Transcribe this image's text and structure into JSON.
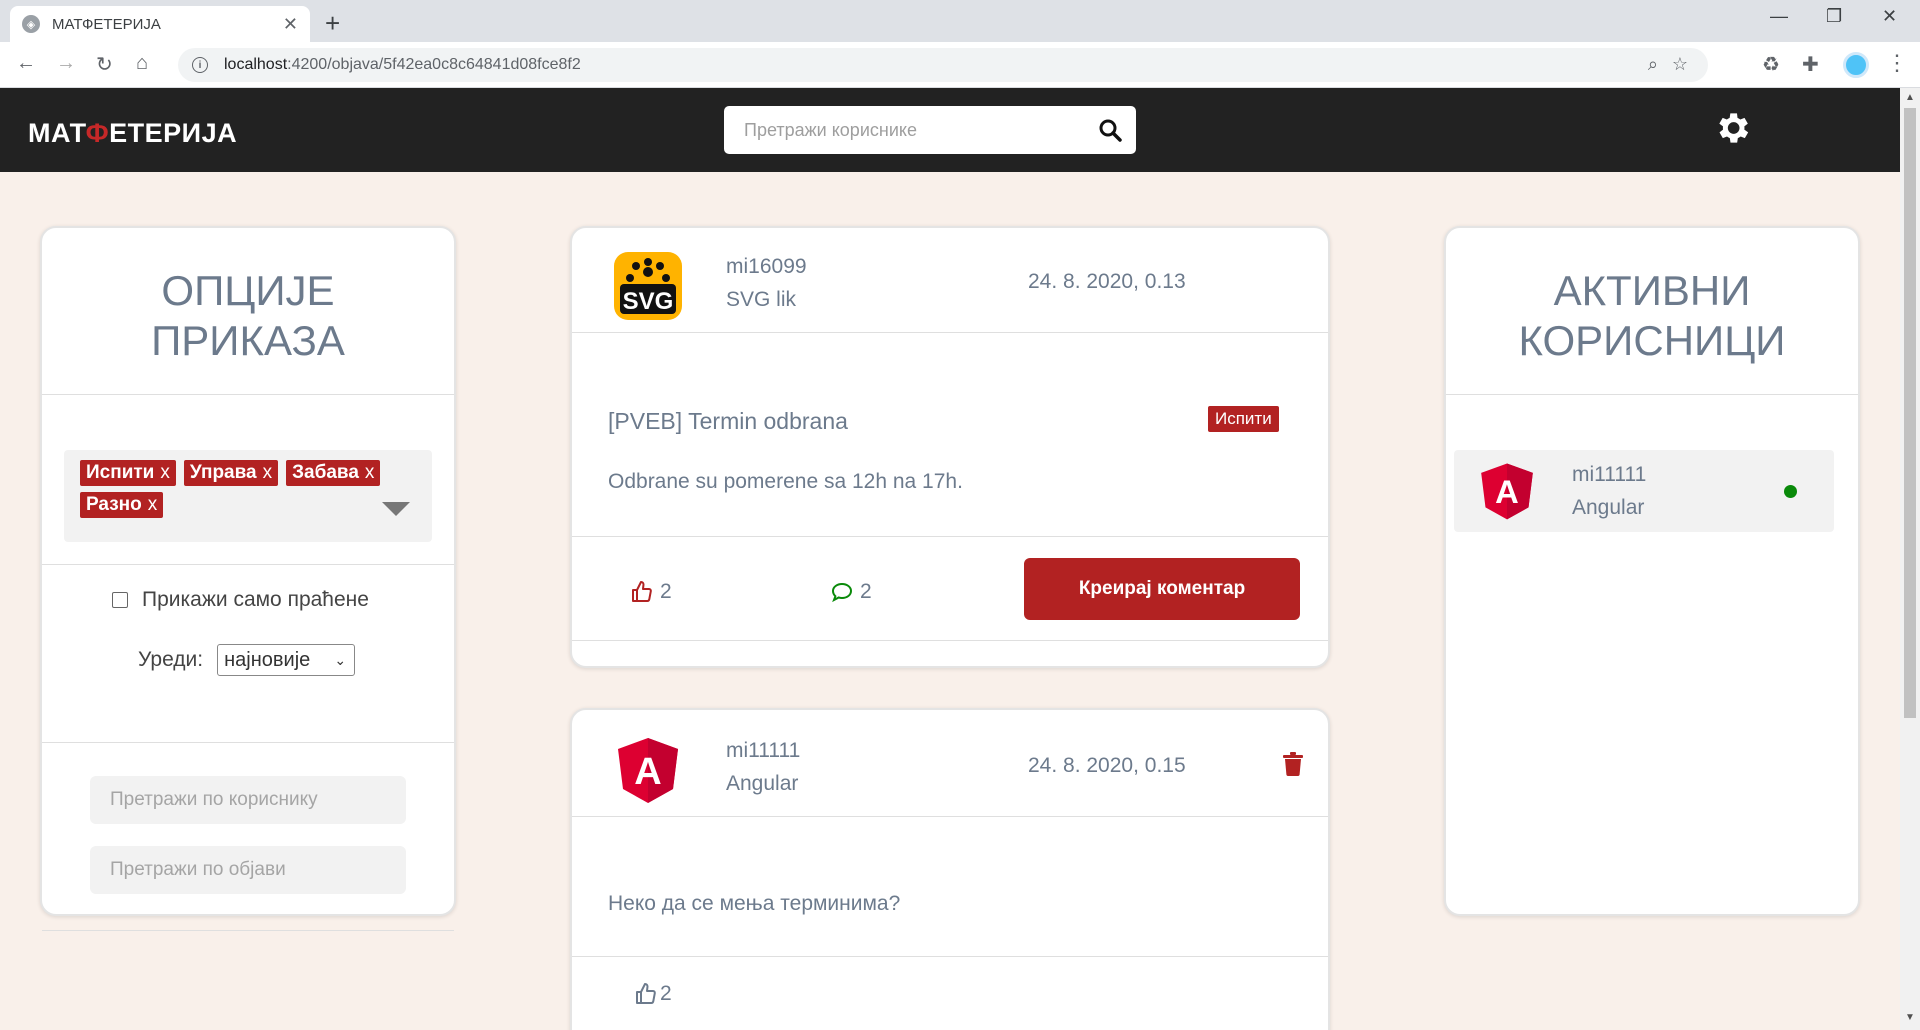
{
  "browser": {
    "tab_title": "МАТФЕТЕРИЈА",
    "new_tab": "+",
    "url_host": "localhost",
    "url_path": ":4200/objava/5f42ea0c8c64841d08fce8f2",
    "minimize": "—",
    "restore": "❐",
    "close": "✕"
  },
  "header": {
    "logo_pre": "МАТ",
    "logo_phi": "Ф",
    "logo_post": "ЕТЕРИЈА",
    "search_placeholder": "Претражи кориснике"
  },
  "left_panel": {
    "title_line1": "ОПЦИЈЕ",
    "title_line2": "ПРИКАЗА",
    "chips": [
      {
        "label": "Испити",
        "remove": "x"
      },
      {
        "label": "Управа",
        "remove": "x"
      },
      {
        "label": "Забава",
        "remove": "x"
      },
      {
        "label": "Разно",
        "remove": "x"
      }
    ],
    "follow_label": "Прикажи само праћене",
    "sort_label": "Уреди:",
    "sort_value": "најновије",
    "user_search_placeholder": "Претражи по кориснику",
    "post_search_placeholder": "Претражи по објави"
  },
  "posts": [
    {
      "username": "mi16099",
      "display_name": "SVG lik",
      "avatar_text": "SVG",
      "date": "24. 8. 2020, 0.13",
      "title": "[PVEB] Termin odbrana",
      "tag": "Испити",
      "body": "Odbrane su pomerene sa 12h na 17h.",
      "likes": "2",
      "comments": "2",
      "comment_button": "Креирај коментар"
    },
    {
      "username": "mi11111",
      "display_name": "Angular",
      "avatar_text": "A",
      "date": "24. 8. 2020, 0.15",
      "body": "Неко да се мења терминима?",
      "likes": "2"
    }
  ],
  "right_panel": {
    "title_line1": "АКТИВНИ",
    "title_line2": "КОРИСНИЦИ",
    "users": [
      {
        "username": "mi11111",
        "display_name": "Angular",
        "avatar_text": "A",
        "status": "online"
      }
    ]
  },
  "colors": {
    "accent": "#b22222",
    "header_bg": "#222222",
    "page_bg": "#f9f0ea",
    "title_text": "#6c7a8c",
    "online": "#0a8a0a"
  }
}
